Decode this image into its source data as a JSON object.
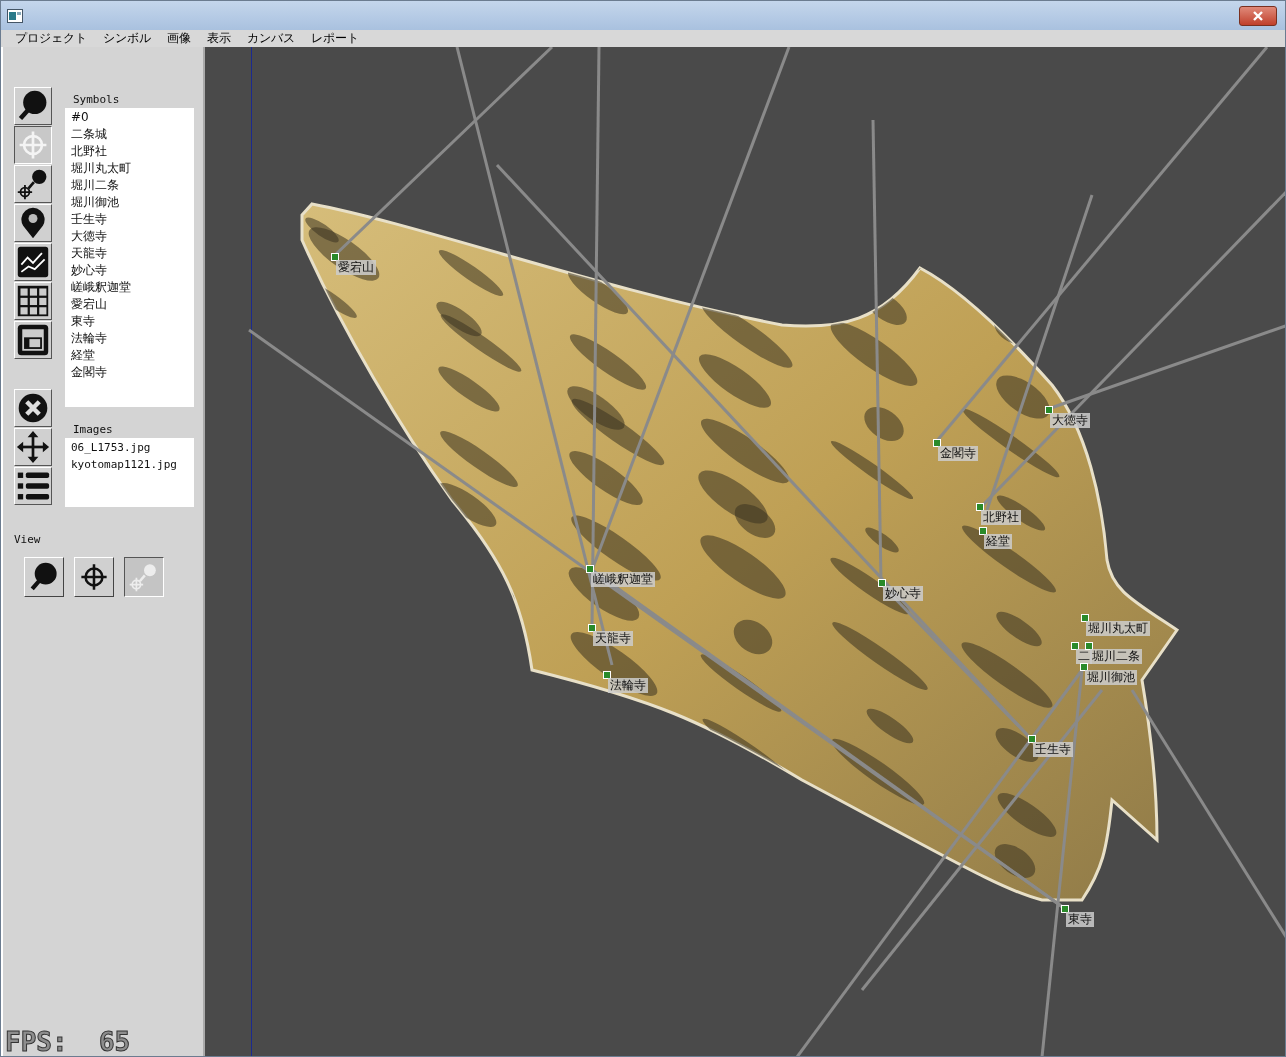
{
  "menu": [
    "プロジェクト",
    "シンボル",
    "画像",
    "表示",
    "カンバス",
    "レポート"
  ],
  "tools": [
    {
      "kind": "search",
      "selected": false
    },
    {
      "kind": "target",
      "selected": true
    },
    {
      "kind": "search-target",
      "selected": false
    },
    {
      "kind": "pin",
      "selected": false
    },
    {
      "kind": "chart",
      "selected": false
    },
    {
      "kind": "grid",
      "selected": false
    },
    {
      "kind": "layout",
      "selected": false
    }
  ],
  "tools_2": [
    {
      "kind": "close",
      "selected": false
    },
    {
      "kind": "move",
      "selected": false
    },
    {
      "kind": "list",
      "selected": false
    }
  ],
  "symbols": {
    "label": "Symbols",
    "items": [
      "#0",
      "二条城",
      "北野社",
      "堀川丸太町",
      "堀川二条",
      "堀川御池",
      "壬生寺",
      "大徳寺",
      "天龍寺",
      "妙心寺",
      "嵯峨釈迦堂",
      "愛宕山",
      "東寺",
      "法輪寺",
      "経堂",
      "金閣寺"
    ]
  },
  "images": {
    "label": "Images",
    "items": [
      "06_L1753.jpg",
      "kyotomap1121.jpg"
    ]
  },
  "view": {
    "label": "View",
    "buttons": [
      {
        "kind": "search",
        "disabled": false
      },
      {
        "kind": "target",
        "disabled": false
      },
      {
        "kind": "search-target",
        "disabled": true
      }
    ]
  },
  "markers": [
    "愛宕山",
    "金閣寺",
    "大徳寺",
    "北野社",
    "経堂",
    "嵯峨釈迦堂",
    "妙心寺",
    "天龍寺",
    "法輪寺",
    "堀川丸太町",
    "二",
    "堀川二条",
    "堀川御池",
    "壬生寺",
    "東寺"
  ],
  "fps": "FPS:  65"
}
